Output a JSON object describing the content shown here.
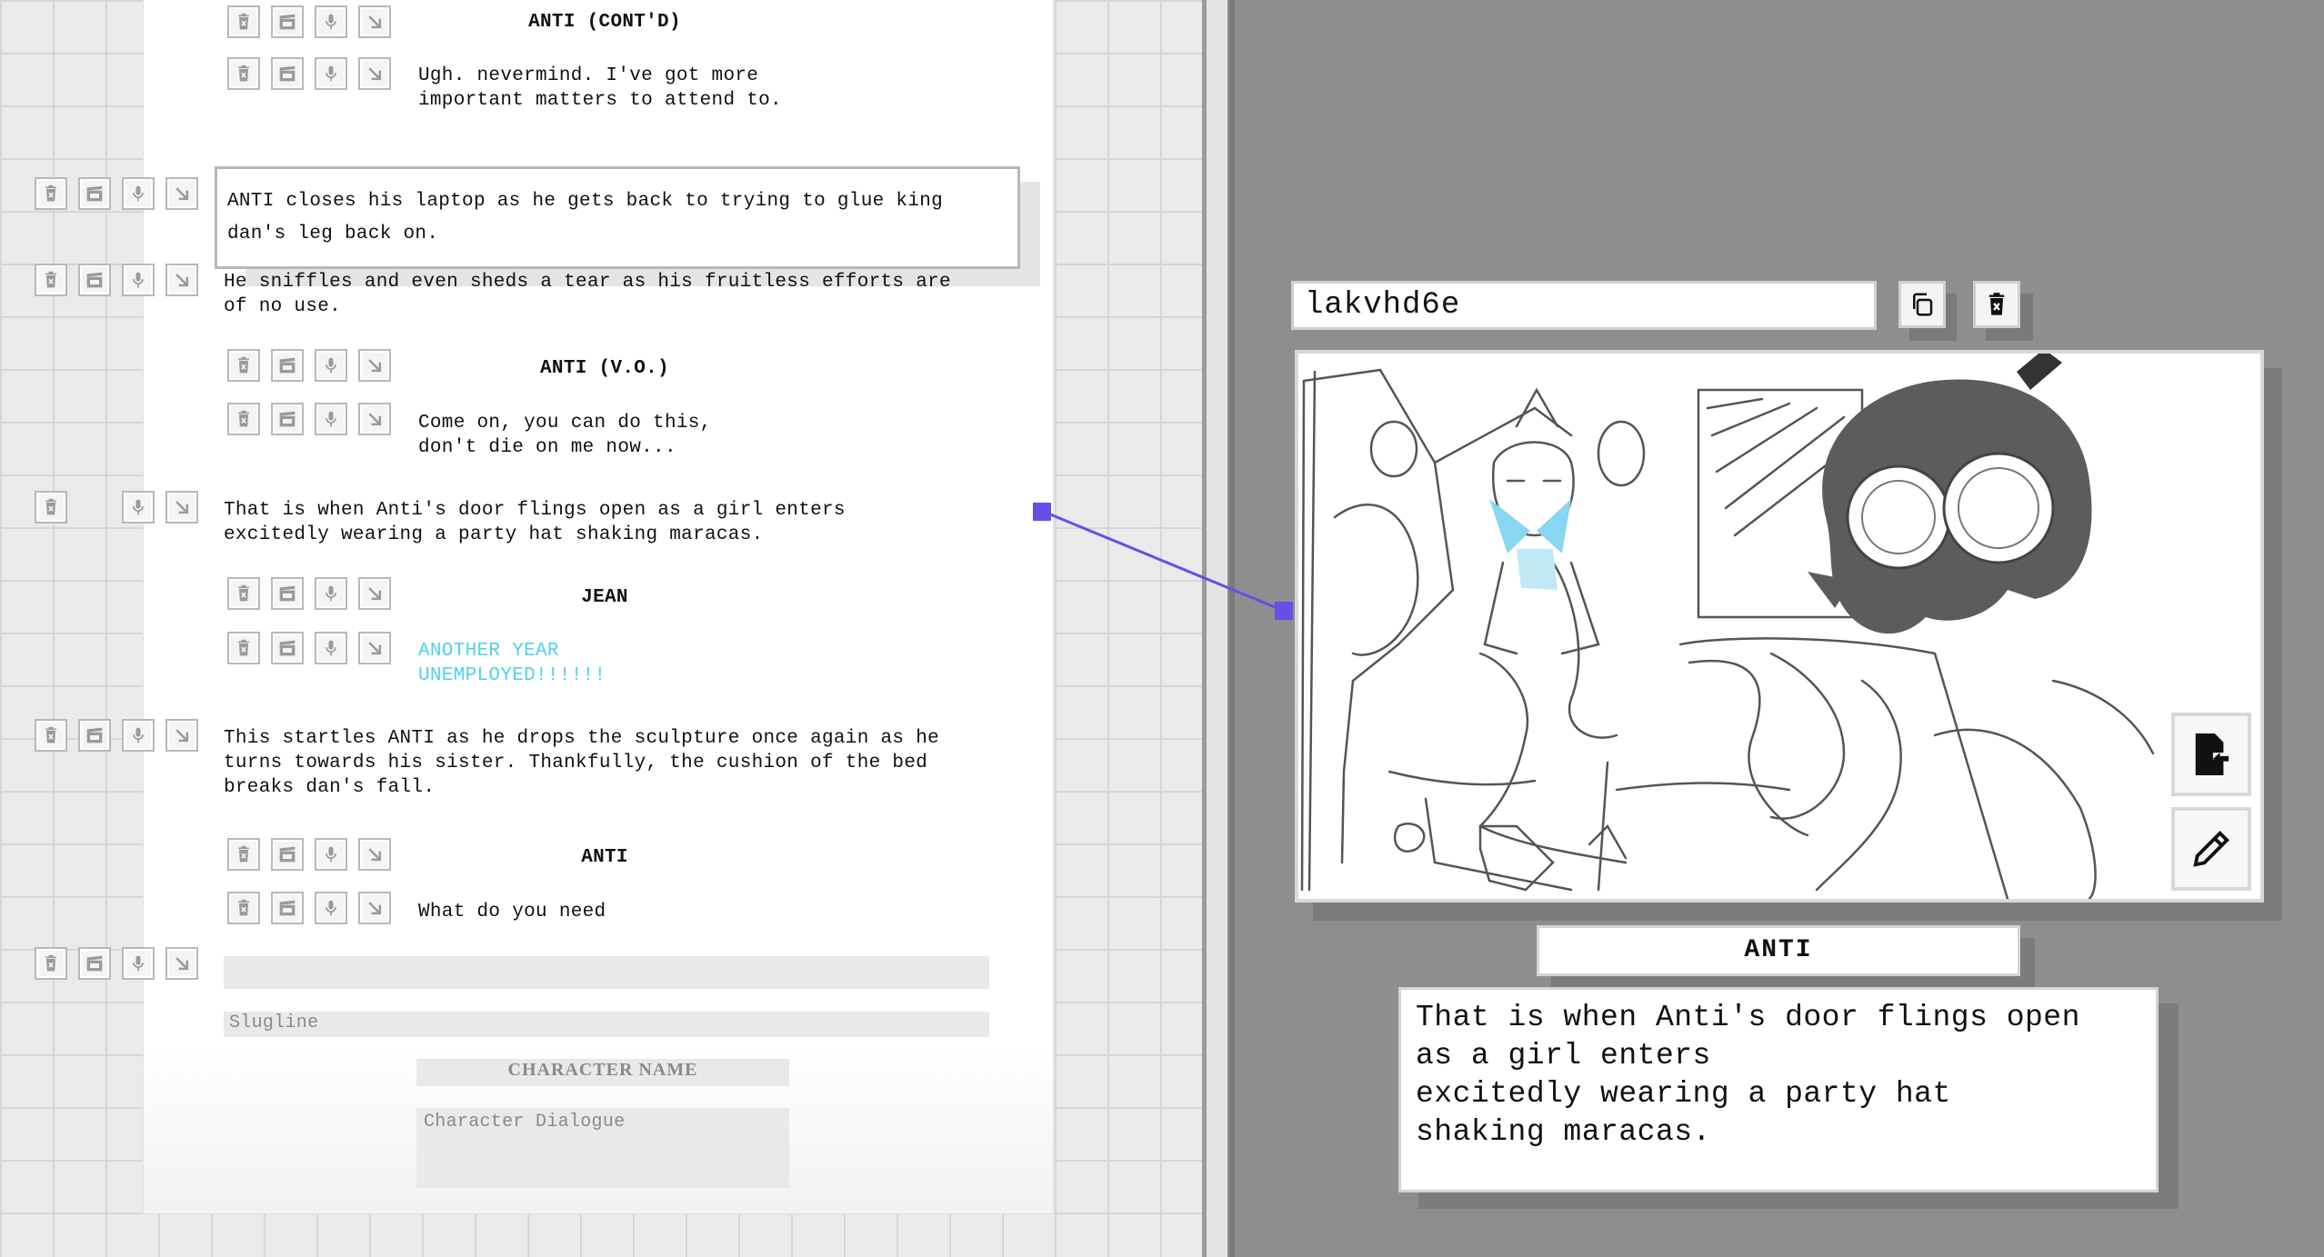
{
  "script": {
    "blocks": [
      {
        "type": "character",
        "text": "ANTI (CONT'D)"
      },
      {
        "type": "dialogue",
        "text": "Ugh. nevermind. I've got more\nimportant matters to attend to."
      },
      {
        "type": "action",
        "text": "ANTI closes his laptop as he gets back to trying to glue king\ndan's leg back on."
      },
      {
        "type": "action",
        "text": "He sniffles and even sheds a tear as his fruitless efforts are\nof no use."
      },
      {
        "type": "character",
        "text": "ANTI (V.O.)"
      },
      {
        "type": "dialogue",
        "text": "Come on, you can do this,\ndon't die on me now..."
      },
      {
        "type": "action",
        "text": "That is when Anti's door flings open as a girl enters\nexcitedly wearing a party hat shaking maracas."
      },
      {
        "type": "character",
        "text": "JEAN"
      },
      {
        "type": "dialogue",
        "text": "ANOTHER YEAR\nUNEMPLOYED!!!!!!"
      },
      {
        "type": "action",
        "text": "This startles ANTI as he drops the sculpture once again as he\nturns towards his sister. Thankfully, the cushion of the bed\nbreaks dan's fall."
      },
      {
        "type": "character",
        "text": "ANTI"
      },
      {
        "type": "dialogue",
        "text": "What do you need"
      }
    ],
    "new_entry": {
      "slugline_placeholder": "Slugline",
      "character_placeholder": "CHARACTER NAME",
      "dialogue_placeholder": "Character Dialogue"
    },
    "icon_names": [
      "trash-icon",
      "storyboard-icon",
      "mic-icon",
      "arrow-down-right-icon"
    ]
  },
  "panel": {
    "id_value": "lakvhd6e",
    "character": "ANTI",
    "description": "That is when Anti's door flings open\nas a girl enters\nexcitedly wearing a party hat\nshaking maracas.",
    "accent_color": "#6a4ce6",
    "highlight_color": "#57d0ef"
  }
}
